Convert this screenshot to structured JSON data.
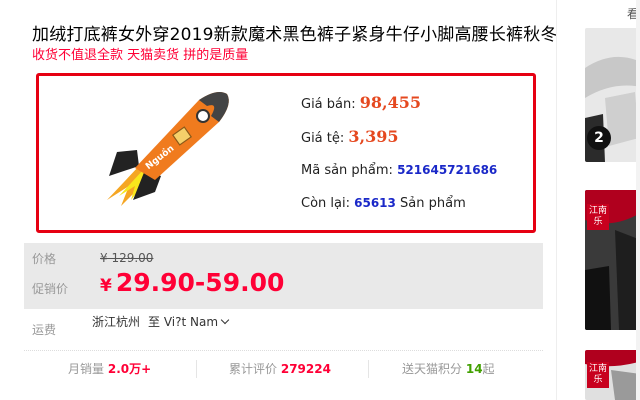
{
  "product": {
    "title": "加绒打底裤女外穿2019新款魔术黑色裤子紧身牛仔小脚高腰长裤秋冬",
    "subtitle": "收货不值退全款 天猫卖货 拼的是质量"
  },
  "extension": {
    "logo_text": "Nguồn",
    "sale_price_label": "Giá bán:",
    "sale_price_value": "98,455",
    "rate_label": "Giá tệ:",
    "rate_value": "3,395",
    "product_code_label": "Mã sản phẩm:",
    "product_code_value": "521645721686",
    "remaining_label": "Còn lại:",
    "remaining_value": "65613",
    "remaining_unit": "Sản phẩm"
  },
  "pricing": {
    "price_label": "价格",
    "original_price": "¥ 129.00",
    "promo_label": "促销价",
    "currency": "¥",
    "promo_price": "29.90-59.00"
  },
  "shipping": {
    "label": "运费",
    "from": "浙江杭州",
    "to": "至 Vi?t Nam"
  },
  "stats": {
    "monthly_sales_label": "月销量",
    "monthly_sales_value": "2.0万+",
    "reviews_label": "累计评价",
    "reviews_value": "279224",
    "points_label": "送天猫积分",
    "points_value": "14",
    "points_suffix": "起"
  },
  "sidebar": {
    "link_label": "看",
    "thumb1_badge": "2",
    "thumb2_tag": "江南乐",
    "thumb3_tag": "江南乐"
  },
  "colors": {
    "accent_red": "#ff0036",
    "extension_border": "#e60012",
    "extension_price": "#e5481f",
    "extension_code": "#1a28c8",
    "points_green": "#41a000"
  }
}
